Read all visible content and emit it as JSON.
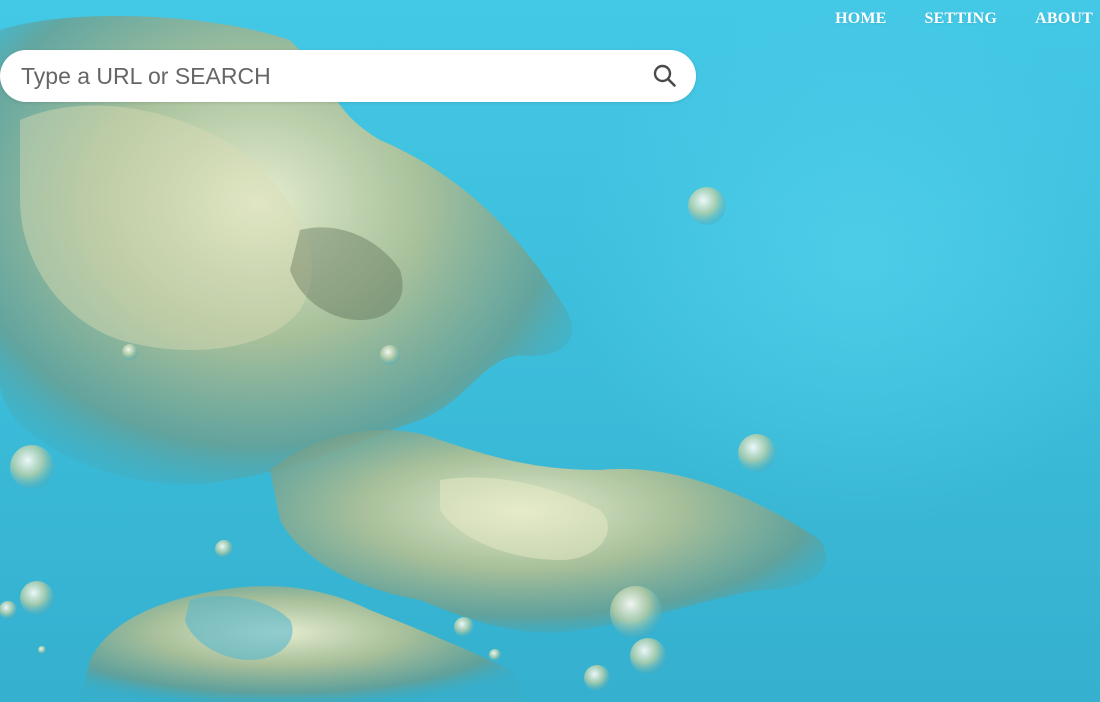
{
  "nav": {
    "items": [
      {
        "label": "HOME"
      },
      {
        "label": "SETTING"
      },
      {
        "label": "ABOUT"
      }
    ]
  },
  "search": {
    "placeholder": "Type a URL or SEARCH",
    "value": "",
    "icon": "search-icon"
  },
  "background": {
    "description": "water bubbles wallpaper",
    "colors": {
      "sky": "#3fc3df",
      "bubble": "#cfd6a8"
    }
  }
}
